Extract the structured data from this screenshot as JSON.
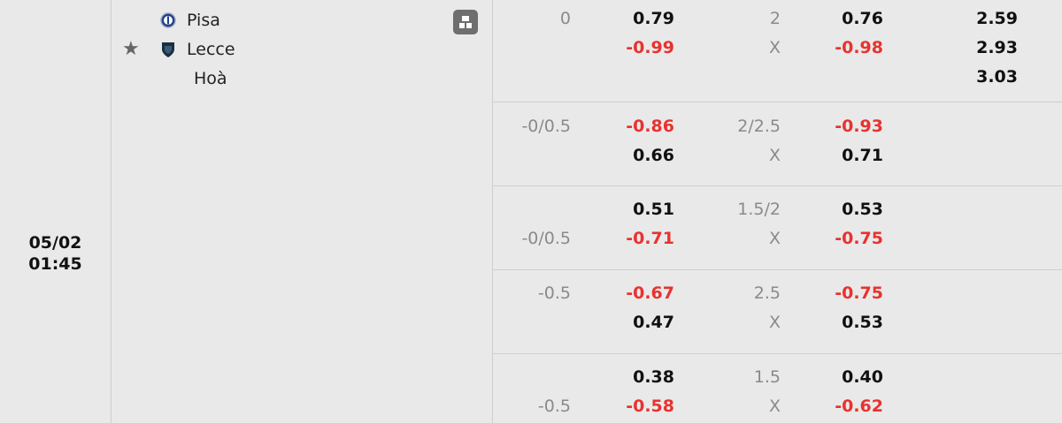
{
  "match": {
    "date": "05/02",
    "time": "01:45",
    "home": "Pisa",
    "away": "Lecce",
    "draw": "Hoà",
    "home_icon": "pisa-crest-icon",
    "away_icon": "lecce-crest-icon",
    "star_icon": "star-icon",
    "stats_icon": "stats-icon"
  },
  "colors": {
    "positive": "#111111",
    "negative": "#e8322f",
    "muted": "#8a8a8a"
  },
  "rows": [
    {
      "handicap": [
        "0",
        ""
      ],
      "handicap_odds": [
        "0.79",
        "-0.99"
      ],
      "total": [
        "2",
        "X"
      ],
      "total_odds": [
        "0.76",
        "-0.98"
      ],
      "x12": [
        "2.59",
        "2.93",
        "3.03"
      ]
    },
    {
      "handicap": [
        "-0/0.5",
        ""
      ],
      "handicap_odds": [
        "-0.86",
        "0.66"
      ],
      "total": [
        "2/2.5",
        "X"
      ],
      "total_odds": [
        "-0.93",
        "0.71"
      ]
    },
    {
      "handicap": [
        "",
        "-0/0.5"
      ],
      "handicap_odds": [
        "0.51",
        "-0.71"
      ],
      "total": [
        "1.5/2",
        "X"
      ],
      "total_odds": [
        "0.53",
        "-0.75"
      ]
    },
    {
      "handicap": [
        "-0.5",
        ""
      ],
      "handicap_odds": [
        "-0.67",
        "0.47"
      ],
      "total": [
        "2.5",
        "X"
      ],
      "total_odds": [
        "-0.75",
        "0.53"
      ]
    },
    {
      "handicap": [
        "",
        "-0.5"
      ],
      "handicap_odds": [
        "0.38",
        "-0.58"
      ],
      "total": [
        "1.5",
        "X"
      ],
      "total_odds": [
        "0.40",
        "-0.62"
      ]
    }
  ]
}
